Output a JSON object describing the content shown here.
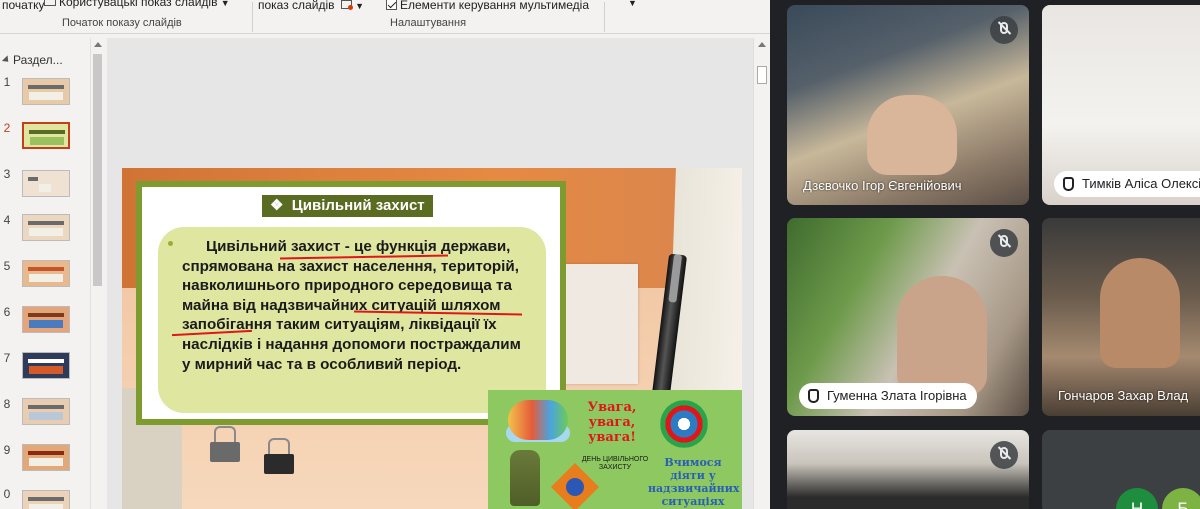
{
  "ribbon": {
    "start_fragment": "початку",
    "custom_show_label": "Користувацькі показ слайдів",
    "group_start_show": "Початок показу слайдів",
    "show_fragment": "показ слайдів",
    "media_controls_label": "Елементи керування мультимедіа",
    "group_settings": "Налаштування"
  },
  "thumbnails": {
    "section_label": "Раздел...",
    "active_slide": 2,
    "slides": [
      "1",
      "2",
      "3",
      "4",
      "5",
      "6",
      "7",
      "8",
      "9",
      "0"
    ]
  },
  "slide": {
    "title": "Цивільний захист",
    "title_bullet": "❖",
    "body_text": "Цивільний захист - це функція держави, спрямована на захист населення, територій, навколишнього природного середовища та майна від надзвичайних ситуацій шляхом запобігання таким ситуаціям, ліквідації їх наслідків і надання допомоги постраждалим у мирний час та в особливий період.",
    "card": {
      "title": "Увага, увага, увага!",
      "day_caption": "ДЕНЬ ЦИВІЛЬНОГО ЗАХИСТУ",
      "subtitle": "Вчимося діяти у надзвичайних ситуаціях"
    }
  },
  "meet": {
    "participants": [
      {
        "name": "Дзєвочко Ігор Євгенійович",
        "muted": true
      },
      {
        "name": "Тимків Аліса Олексі",
        "hand_raised": true
      },
      {
        "name": "Гуменна Злата Ігорівна",
        "muted": true,
        "hand_raised": true
      },
      {
        "name": "Гончаров Захар Влад"
      },
      {
        "name": "",
        "muted": true
      }
    ],
    "avatar_initials": [
      "H",
      "Б"
    ],
    "avatar_colors": [
      "#1e8e3e",
      "#7cb342"
    ]
  },
  "colors": {
    "accent_red": "#e0161b",
    "slide_green": "#7d9b2f",
    "meet_bg": "#202124"
  }
}
